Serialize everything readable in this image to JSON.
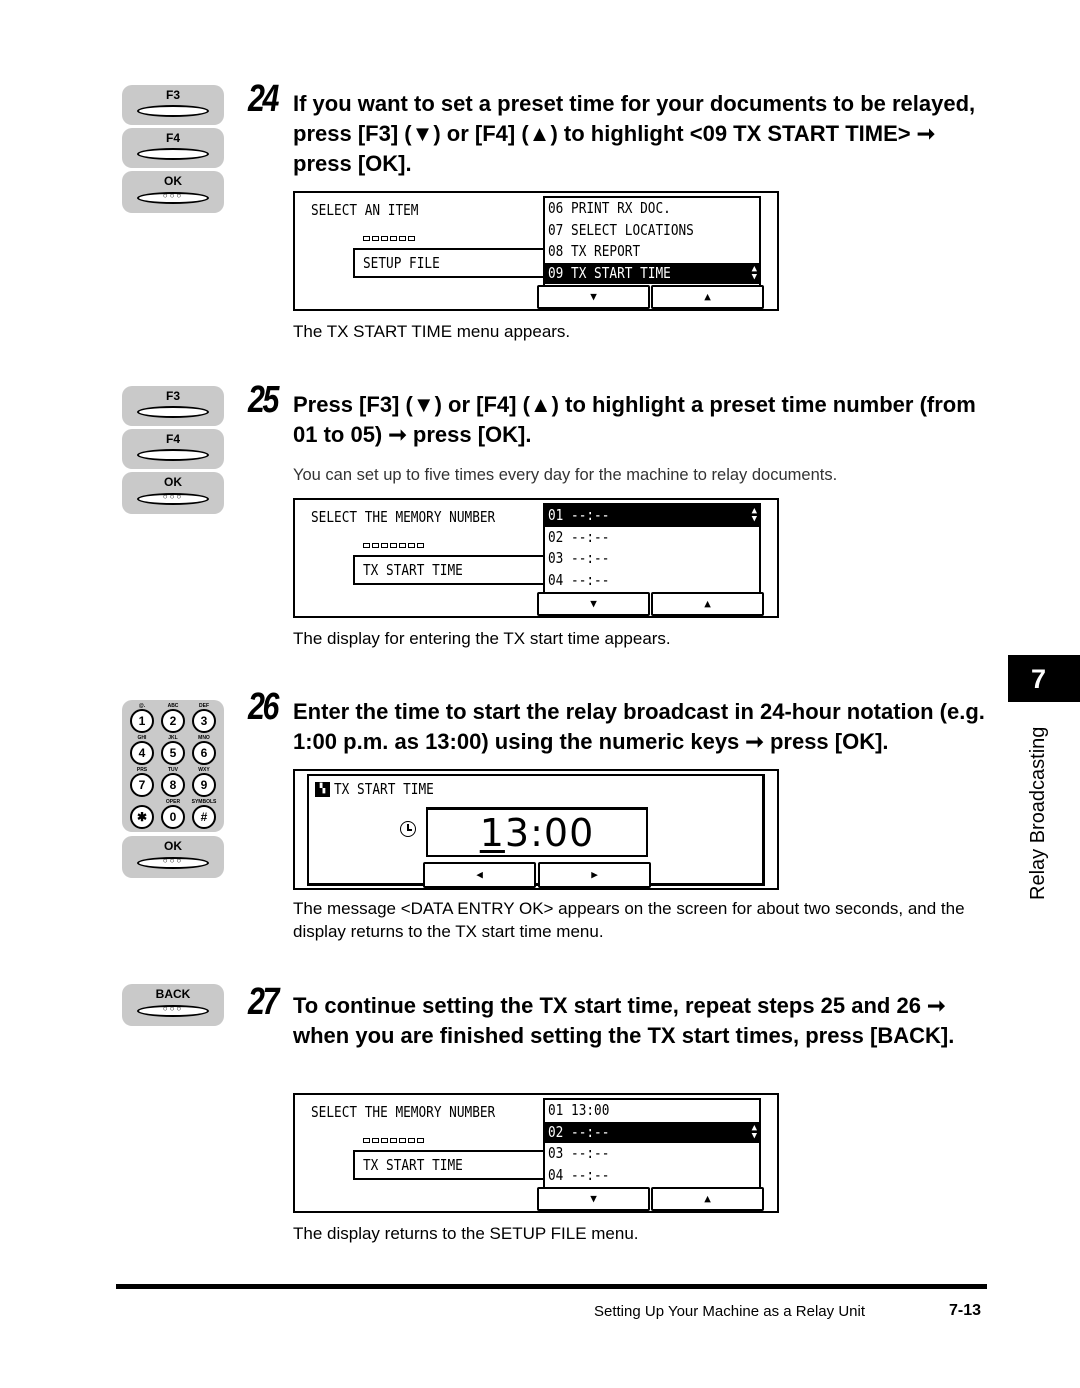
{
  "keys": {
    "f3": "F3",
    "f4": "F4",
    "ok": "OK",
    "back": "BACK",
    "ok_dots": "○○○",
    "keypad": [
      {
        "num": "1",
        "sub": "@."
      },
      {
        "num": "2",
        "sub": "ABC"
      },
      {
        "num": "3",
        "sub": "DEF"
      },
      {
        "num": "4",
        "sub": "GHI"
      },
      {
        "num": "5",
        "sub": "JKL"
      },
      {
        "num": "6",
        "sub": "MNO"
      },
      {
        "num": "7",
        "sub": "PRS"
      },
      {
        "num": "8",
        "sub": "TUV"
      },
      {
        "num": "9",
        "sub": "WXY"
      },
      {
        "num": "✱",
        "sub": ""
      },
      {
        "num": "0",
        "sub": "OPER"
      },
      {
        "num": "#",
        "sub": "SYMBOLS"
      }
    ]
  },
  "steps": [
    {
      "number": "24",
      "text": "If you want to set a preset time for your documents to be relayed, press [F3] (▼) or [F4] (▲) to highlight <09 TX START TIME> ➞ press [OK].",
      "screen": {
        "title": "SELECT AN ITEM",
        "field": "SETUP FILE",
        "list": [
          "06  PRINT RX DOC.",
          "07  SELECT LOCATIONS",
          "08  TX REPORT",
          "09  TX START TIME"
        ],
        "selected_index": 3,
        "down_label": "▼",
        "up_label": "▲"
      },
      "note": "The TX START TIME menu appears."
    },
    {
      "number": "25",
      "text": "Press [F3] (▼) or [F4] (▲) to highlight a preset time number (from 01 to 05) ➞ press [OK].",
      "subnote": "You can set up to five times every day for the machine to relay documents.",
      "screen": {
        "title": "SELECT THE MEMORY NUMBER",
        "field": "TX START TIME",
        "list": [
          "01  --:--",
          "02  --:--",
          "03  --:--",
          "04  --:--"
        ],
        "selected_index": 0,
        "down_label": "▼",
        "up_label": "▲"
      },
      "note": "The display for entering the TX start time appears."
    },
    {
      "number": "26",
      "text": "Enter the time to start the relay broadcast in 24-hour notation (e.g. 1:00 p.m. as 13:00) using the numeric keys ➞ press [OK].",
      "screen": {
        "title": "TX START TIME",
        "time_cursor_digit": "1",
        "time_rest": "3:00",
        "left_label": "◀",
        "right_label": "▶"
      },
      "note": "The message <DATA ENTRY OK> appears on the screen for about two seconds, and the display returns to the TX start time menu."
    },
    {
      "number": "27",
      "text": "To continue setting the TX start time, repeat steps 25 and 26 ➞ when you are finished setting the TX start times, press [BACK].",
      "screen": {
        "title": "SELECT THE MEMORY NUMBER",
        "field": "TX START TIME",
        "list": [
          "01  13:00",
          "02  --:--",
          "03  --:--",
          "04  --:--"
        ],
        "selected_index": 1,
        "down_label": "▼",
        "up_label": "▲"
      },
      "note": "The display returns to the SETUP FILE menu."
    }
  ],
  "side_tab": {
    "chapter": "7",
    "label": "Relay Broadcasting"
  },
  "footer": {
    "section": "Setting Up Your Machine as a Relay Unit",
    "page": "7-13"
  }
}
